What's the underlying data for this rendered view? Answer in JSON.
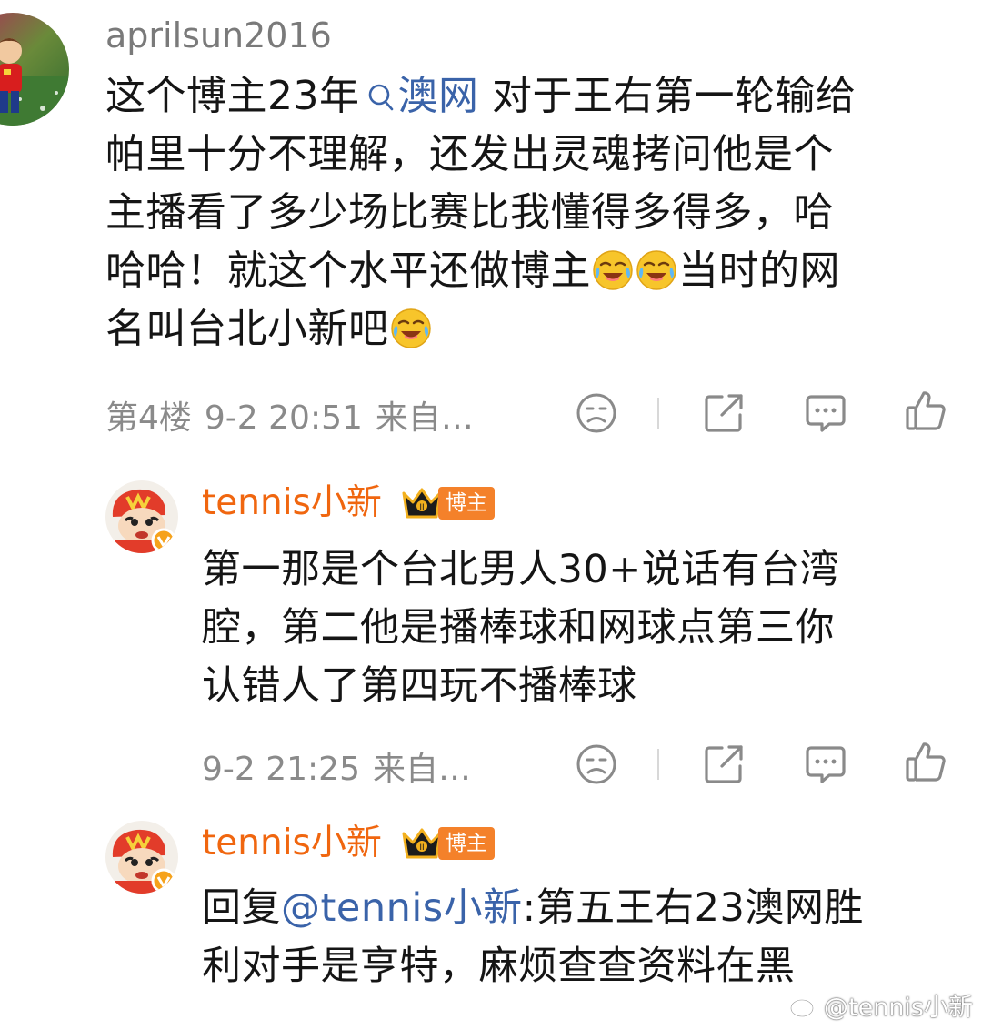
{
  "comment": {
    "username": "aprilsun2016",
    "text_lines": [
      {
        "before": "这个博主23年",
        "topic": "澳网",
        "after": " 对于王右第一轮输给"
      },
      {
        "text": "帕里十分不理解，还发出灵魂拷问他是个"
      },
      {
        "text": "主播看了多少场比赛比我懂得多得多，哈"
      },
      {
        "before": "哈哈！就这个水平还做博主",
        "after": "当时的网"
      },
      {
        "before": "名叫台北小新吧"
      }
    ],
    "floor": "第4楼",
    "time": "9-2 20:51",
    "source": "来自…",
    "emoji_name": "laughing-crying-emoji"
  },
  "replies": [
    {
      "username": "tennis小新",
      "badge": "博主",
      "lines": [
        "第一那是个台北男人30+说话有台湾",
        "腔，第二他是播棒球和网球点第三你",
        "认错人了第四玩不播棒球"
      ],
      "time": "9-2 21:25",
      "source": "来自…"
    },
    {
      "username": "tennis小新",
      "badge": "博主",
      "reply_prefix": "回复",
      "mention": "@tennis小新",
      "line1_after": ":第五王右23澳网胜",
      "line2": "利对手是亨特，麻烦查查资料在黑"
    }
  ],
  "watermark": "@tennis小新",
  "colors": {
    "username_reply": "#f0660f",
    "link": "#3a63a9",
    "meta": "#8a8a8a",
    "badge": "#f4812a"
  }
}
